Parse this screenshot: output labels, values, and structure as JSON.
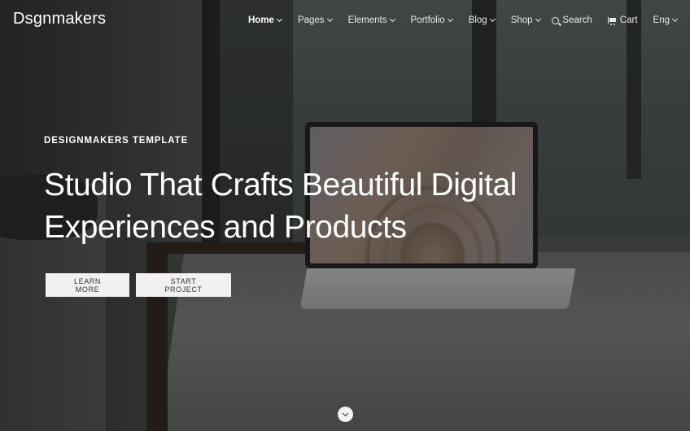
{
  "header": {
    "logo": "Dsgnmakers",
    "nav": [
      {
        "label": "Home",
        "active": true
      },
      {
        "label": "Pages",
        "active": false
      },
      {
        "label": "Elements",
        "active": false
      },
      {
        "label": "Portfolio",
        "active": false
      },
      {
        "label": "Blog",
        "active": false
      },
      {
        "label": "Shop",
        "active": false
      }
    ],
    "search_label": "Search",
    "cart_label": "Cart",
    "language_label": "Eng",
    "icons": {
      "search": "search-icon",
      "cart": "cart-icon",
      "dropdown": "chevron-down-icon"
    }
  },
  "hero": {
    "eyebrow": "DESIGNMAKERS TEMPLATE",
    "headline_line1": "Studio That Crafts Beautiful Digital",
    "headline_line2": "Experiences and Products",
    "primary_button": "LEARN MORE",
    "secondary_button": "START PROJECT",
    "scroll_icon": "chevron-down-icon"
  },
  "colors": {
    "text": "#ffffff",
    "button_bg": "#f1f1f1",
    "button_text": "#333333"
  }
}
